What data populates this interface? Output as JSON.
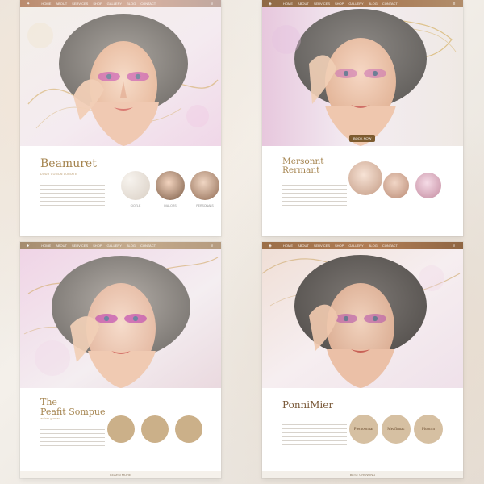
{
  "colors": {
    "gold": "#a5844f",
    "rose": "#d8a6c2",
    "accent_brown": "#7d5b2f"
  },
  "panels": [
    {
      "title": "Beamuret",
      "subtitle": "DOUR COMON LORIATE",
      "nav": [
        "HOME",
        "ABOUT",
        "SERVICES",
        "SHOP",
        "GALLERY",
        "BLOG",
        "CONTACT"
      ],
      "captions": [
        "CIOTLE",
        "DIALORS",
        "PERSONALS"
      ]
    },
    {
      "title": "Mersonnt\nRermant",
      "subtitle": "",
      "nav": [
        "HOME",
        "ABOUT",
        "SERVICES",
        "SHOP",
        "GALLERY",
        "BLOG",
        "CONTACT"
      ],
      "button": "BOOK NOW",
      "captions": [
        "",
        "",
        ""
      ]
    },
    {
      "title": "The\nPeafit Sompue",
      "subtitle": "aniaro gumas",
      "nav": [
        "HOME",
        "ABOUT",
        "SERVICES",
        "SHOP",
        "GALLERY",
        "BLOG",
        "CONTACT"
      ],
      "footer": "LEARN MORE",
      "captions": [
        "",
        "",
        ""
      ]
    },
    {
      "title": "PonniMier",
      "subtitle": "",
      "nav": [
        "HOME",
        "ABOUT",
        "SERVICES",
        "SHOP",
        "GALLERY",
        "BLOG",
        "CONTACT"
      ],
      "circle_labels": [
        "Plemoonnar",
        "Meafinnac",
        "Pluotrin"
      ],
      "footer": "BEST GROWING"
    }
  ]
}
